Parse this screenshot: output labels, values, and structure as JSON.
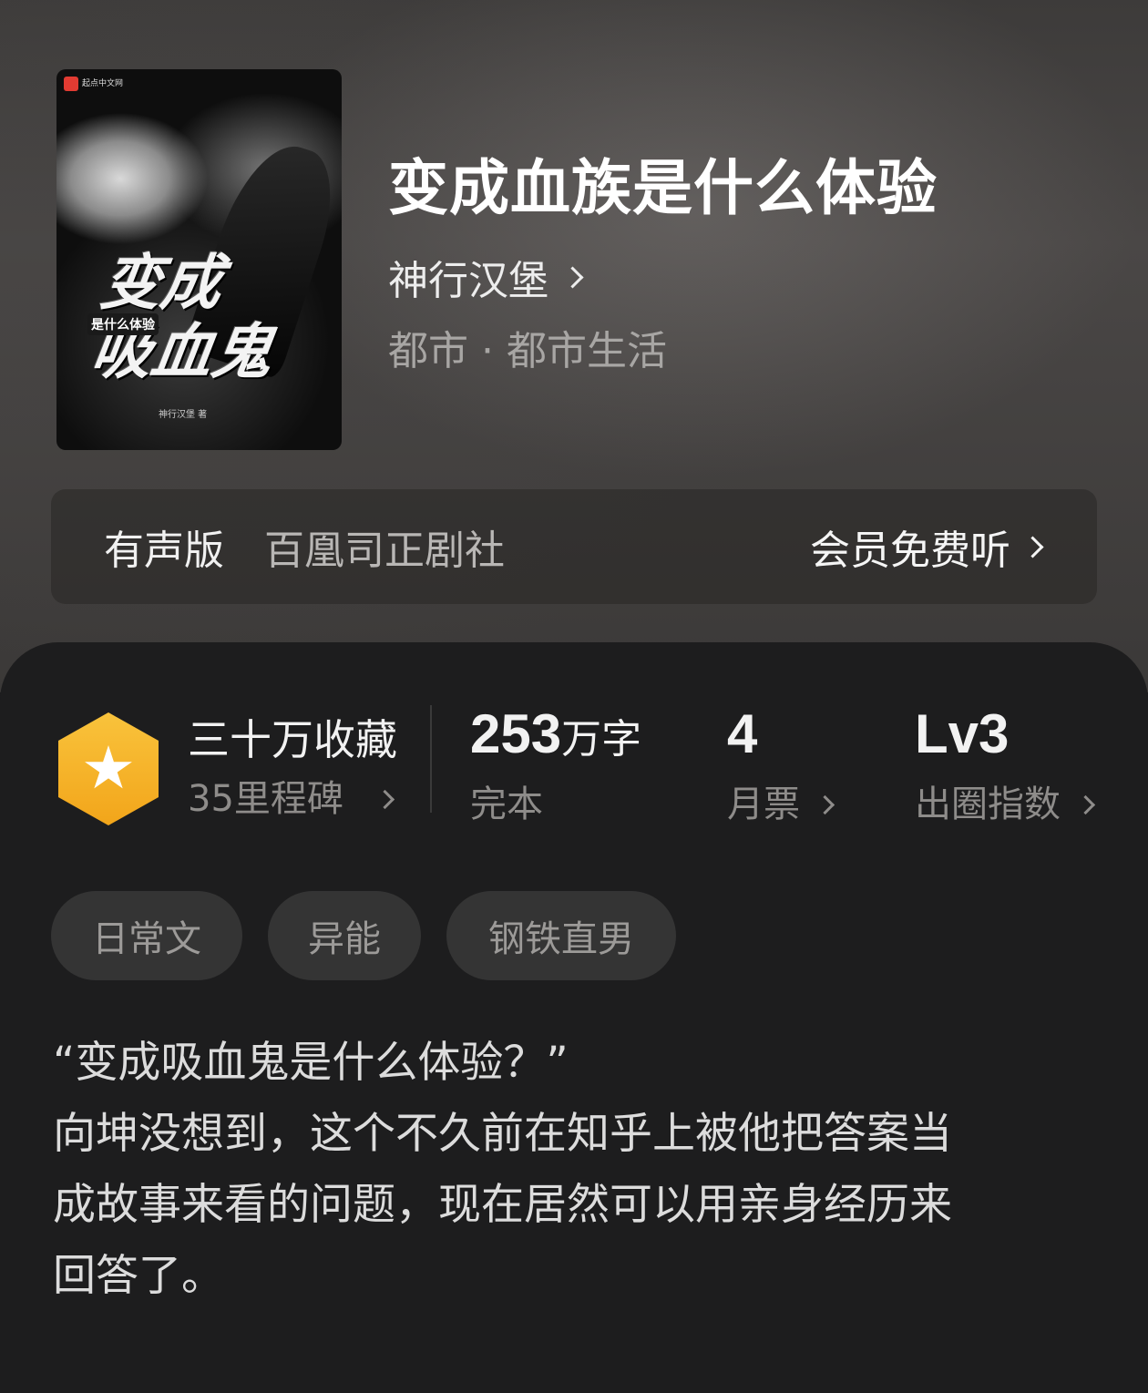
{
  "book": {
    "title": "变成血族是什么体验",
    "author": "神行汉堡",
    "genre": "都市 · 都市生活",
    "cover": {
      "publisher": "起点中文网",
      "art_title_line1": "变成",
      "art_title_line2": "吸血鬼",
      "art_subtitle": "是什么体验",
      "art_author": "神行汉堡 著"
    }
  },
  "audio": {
    "label": "有声版",
    "studio": "百凰司正剧社",
    "cta": "会员免费听"
  },
  "stats": {
    "collection_title": "三十万收藏",
    "milestones": "35里程碑",
    "words_number": "253",
    "words_unit": "万字",
    "status": "完本",
    "monthly_tickets_value": "4",
    "monthly_tickets_label": "月票",
    "influence_value": "Lv3",
    "influence_label": "出圈指数"
  },
  "tags": [
    "日常文",
    "异能",
    "钢铁直男"
  ],
  "description": {
    "line1": "“变成吸血鬼是什么体验？”",
    "line2": "向坤没想到，这个不久前在知乎上被他把答案当",
    "line3": "成故事来看的问题，现在居然可以用亲身经历来",
    "line4": "回答了。"
  },
  "colors": {
    "background": "#1d1d1e",
    "badge_gold": "#f5b42a",
    "tag_bg": "#343434"
  },
  "icons": [
    "star-icon",
    "chevron-right-icon"
  ]
}
